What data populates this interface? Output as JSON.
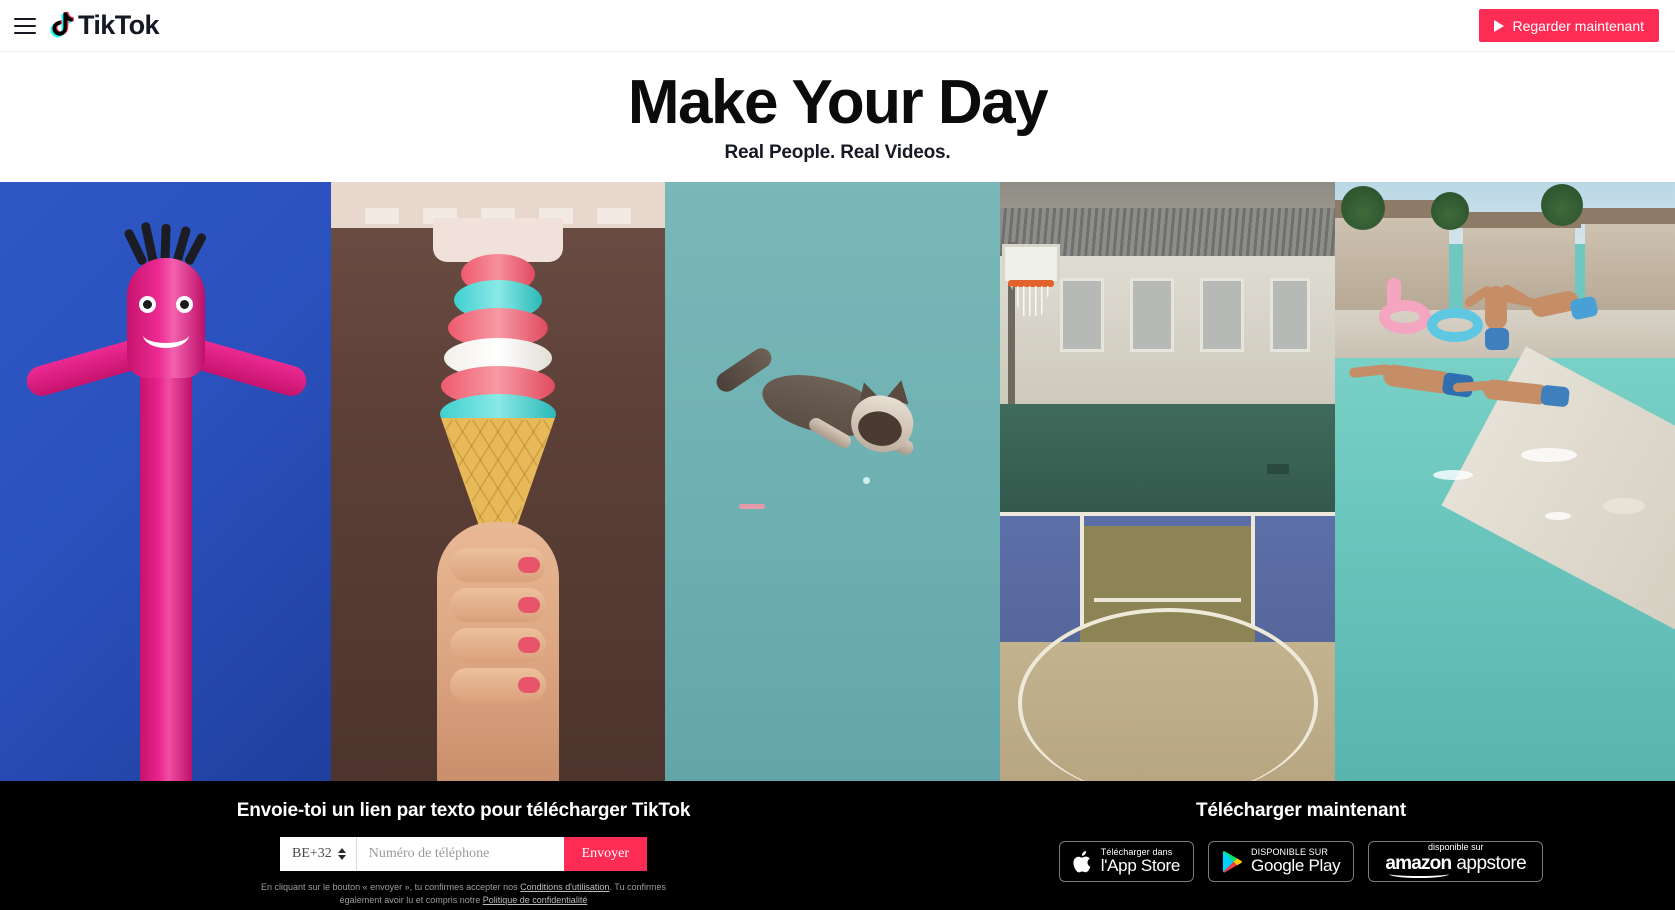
{
  "header": {
    "menu_icon": "hamburger-icon",
    "logo_text": "TikTok",
    "watch_button": "Regarder maintenant",
    "watch_icon": "play-icon",
    "accent_color": "#fe2c55"
  },
  "hero": {
    "title": "Make Your Day",
    "subtitle": "Real People. Real Videos."
  },
  "video_strip": {
    "panels": [
      {
        "alt": "Pink inflatable tube man dancing on blue background"
      },
      {
        "alt": "Hand holding a rainbow swirl soft-serve ice cream cone"
      },
      {
        "alt": "Siamese cat leaping through the air on teal background"
      },
      {
        "alt": "Outdoor basketball court with hoop and building"
      },
      {
        "alt": "People diving into a backyard swimming pool"
      }
    ]
  },
  "footer": {
    "sms": {
      "title": "Envoie-toi un lien par texto pour télécharger TikTok",
      "country_code": "BE+32",
      "phone_placeholder": "Numéro de téléphone",
      "phone_value": "",
      "send_label": "Envoyer",
      "legal_prefix": "En cliquant sur le bouton « envoyer », tu confirmes accepter nos ",
      "legal_link1": "Conditions d'utilisation",
      "legal_middle": ". Tu confirmes également avoir lu et compris notre ",
      "legal_link2": "Politique de confidentialité"
    },
    "download": {
      "title": "Télécharger maintenant",
      "badges": [
        {
          "icon": "apple-icon",
          "small": "Télécharger dans",
          "big": "l'App Store"
        },
        {
          "icon": "google-play-icon",
          "small": "DISPONIBLE SUR",
          "big": "Google Play"
        },
        {
          "icon": "amazon-icon",
          "small": "disponible sur",
          "big": "amazon",
          "big2": "appstore"
        }
      ]
    }
  }
}
